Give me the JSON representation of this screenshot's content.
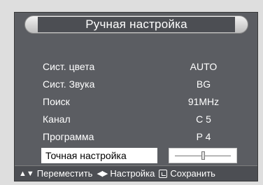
{
  "title": "Ручная настройка",
  "menu": {
    "items": [
      {
        "label": "Сист. цвета",
        "value": "AUTO"
      },
      {
        "label": "Сист. Звука",
        "value": "BG"
      },
      {
        "label": "Поиск",
        "value": "91MHz"
      },
      {
        "label": "Канал",
        "value": "C  5"
      },
      {
        "label": "Программа",
        "value": "P  4"
      },
      {
        "label": "Точная настройка",
        "value": ""
      }
    ],
    "selected_index": 5
  },
  "fine_tune": {
    "level_fraction": 0.5
  },
  "help": {
    "move_icon": "up-down-arrows-icon",
    "move_label": "Переместить",
    "adjust_icon": "left-right-arrows-icon",
    "adjust_label": "Настройка",
    "save_icon": "enter-icon",
    "save_label": "Сохранить"
  }
}
